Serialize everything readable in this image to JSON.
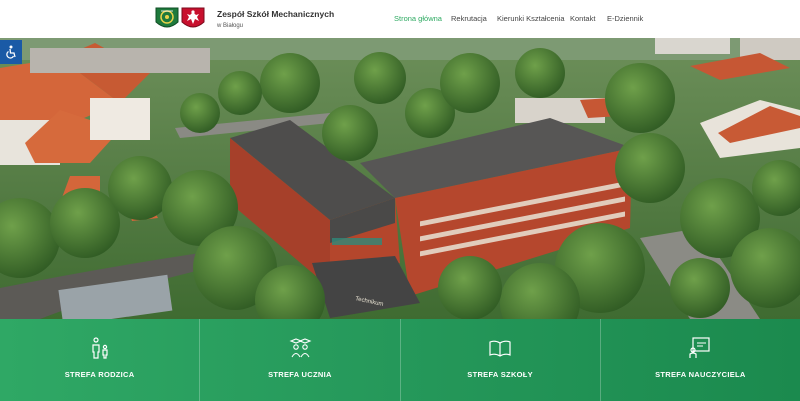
{
  "header": {
    "school_name": "Zespół Szkół Mechanicznych",
    "school_city": "w Białogu"
  },
  "nav": {
    "items": [
      {
        "label": "Strona główna",
        "active": true
      },
      {
        "label": "Rekrutacja",
        "active": false
      },
      {
        "label": "Kierunki Kształcenia",
        "active": false
      },
      {
        "label": "Kontakt",
        "active": false
      },
      {
        "label": "E-Dziennik",
        "active": false
      }
    ]
  },
  "hero": {
    "building_sign": "Technikum",
    "accessibility_icon": "wheelchair-icon"
  },
  "zones": [
    {
      "label": "STREFA RODZICA",
      "icon": "parent-child-icon"
    },
    {
      "label": "STREFA UCZNIA",
      "icon": "students-icon"
    },
    {
      "label": "STREFA SZKOŁY",
      "icon": "open-book-icon"
    },
    {
      "label": "STREFA NAUCZYCIELA",
      "icon": "teacher-board-icon"
    }
  ],
  "colors": {
    "accent": "#2eaa62",
    "zone_bar_start": "#2fa865",
    "zone_bar_end": "#1b8a4e",
    "accessibility": "#1a5aa6"
  }
}
